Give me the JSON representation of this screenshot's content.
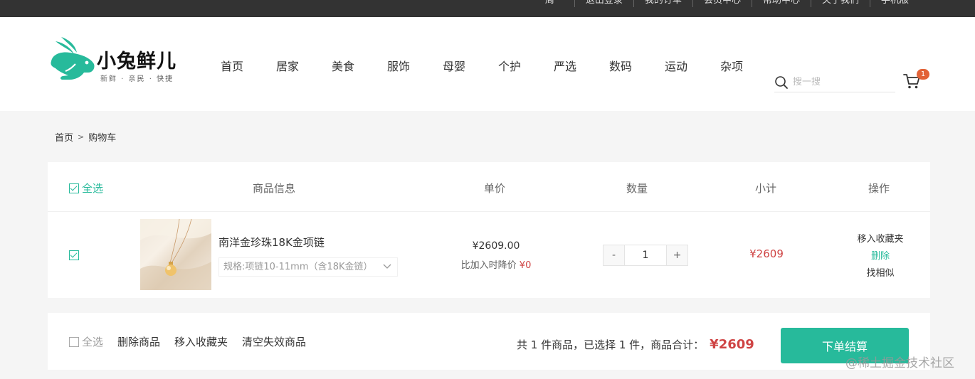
{
  "topbar": {
    "links": [
      "周一",
      "退出登录",
      "我的订单",
      "会员中心",
      "帮助中心",
      "关于我们",
      "手机版"
    ]
  },
  "header": {
    "brand": "小兔鲜儿",
    "slogan": "新鲜 · 亲民 · 快捷",
    "nav": [
      "首页",
      "居家",
      "美食",
      "服饰",
      "母婴",
      "个护",
      "严选",
      "数码",
      "运动",
      "杂项"
    ],
    "search_placeholder": "搜一搜",
    "cart_count": "1"
  },
  "breadcrumb": {
    "home": "首页",
    "sep": ">",
    "current": "购物车"
  },
  "table": {
    "select_all": "全选",
    "columns": [
      "商品信息",
      "单价",
      "数量",
      "小计",
      "操作"
    ]
  },
  "item": {
    "name": "南洋金珍珠18K金项链",
    "spec": "规格:项链10-11mm（含18K金链）",
    "price": "¥2609.00",
    "price_note_label": "比加入时降价",
    "price_note_value": "¥0",
    "quantity": "1",
    "minus": "-",
    "plus": "+",
    "subtotal": "¥2609",
    "ops": [
      "移入收藏夹",
      "删除",
      "找相似"
    ]
  },
  "action_bar": {
    "select_all": "全选",
    "actions": [
      "删除商品",
      "移入收藏夹",
      "清空失效商品"
    ],
    "summary": "共 1 件商品，已选择 1 件，商品合计：",
    "total": "¥2609",
    "checkout": "下单结算"
  },
  "watermark": "@稀土掘金技术社区",
  "colors": {
    "accent": "#27ba9b",
    "price_red": "#cf4444",
    "badge": "#e26237",
    "topbar": "#333333"
  }
}
